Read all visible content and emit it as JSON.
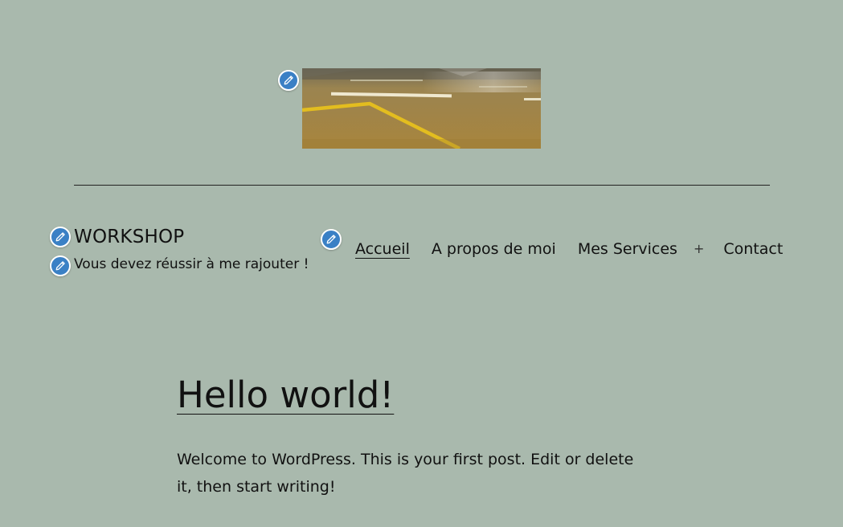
{
  "site": {
    "title": "WORKSHOP",
    "tagline": "Vous devez réussir à me rajouter !"
  },
  "header": {
    "image_alt": "Road with yellow lane markings"
  },
  "navigation": {
    "items": [
      {
        "label": "Accueil",
        "current": true
      },
      {
        "label": "A propos de moi",
        "current": false
      },
      {
        "label": "Mes Services",
        "current": false,
        "has_submenu": true
      },
      {
        "label": "Contact",
        "current": false
      }
    ],
    "submenu_toggle": "+"
  },
  "post": {
    "title": "Hello world!",
    "content": "Welcome to WordPress. This is your first post. Edit or delete it, then start writing!"
  },
  "theme": {
    "background": "#a9b9ad",
    "edit_button_color": "#3a80c5",
    "text_color": "#111111"
  },
  "icons": {
    "edit": "pencil-icon"
  }
}
